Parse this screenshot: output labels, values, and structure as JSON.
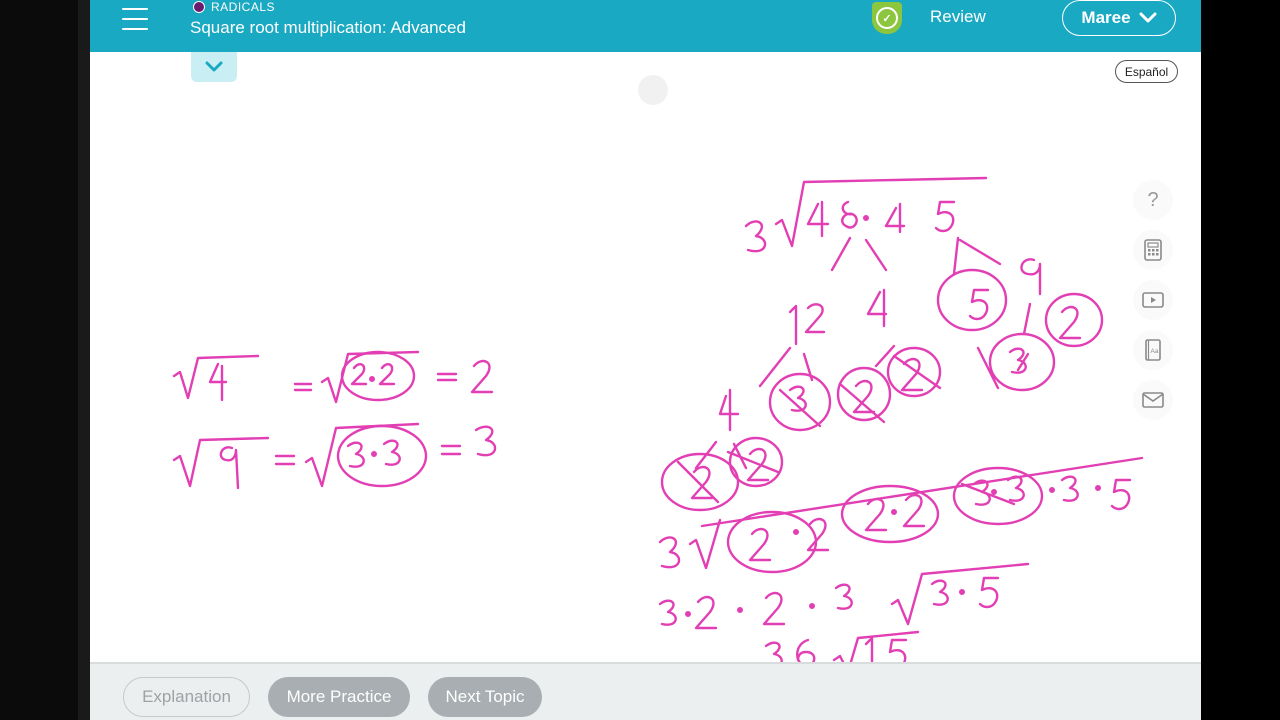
{
  "header": {
    "topic_label": "RADICALS",
    "lesson_title": "Square root multiplication: Advanced",
    "review_label": "Review",
    "user_name": "Maree"
  },
  "language_toggle": "Español",
  "footer": {
    "explanation_label": "Explanation",
    "more_practice_label": "More Practice",
    "next_topic_label": "Next Topic"
  },
  "tools": {
    "help_symbol": "?",
    "items": [
      "help-icon",
      "calculator-icon",
      "video-icon",
      "glossary-icon",
      "mail-icon"
    ]
  },
  "colors": {
    "topbar": "#1aa9c2",
    "ink": "#e23fb4",
    "review_badge": "#8cc63f",
    "footer_btn": "#a8aeb1"
  }
}
